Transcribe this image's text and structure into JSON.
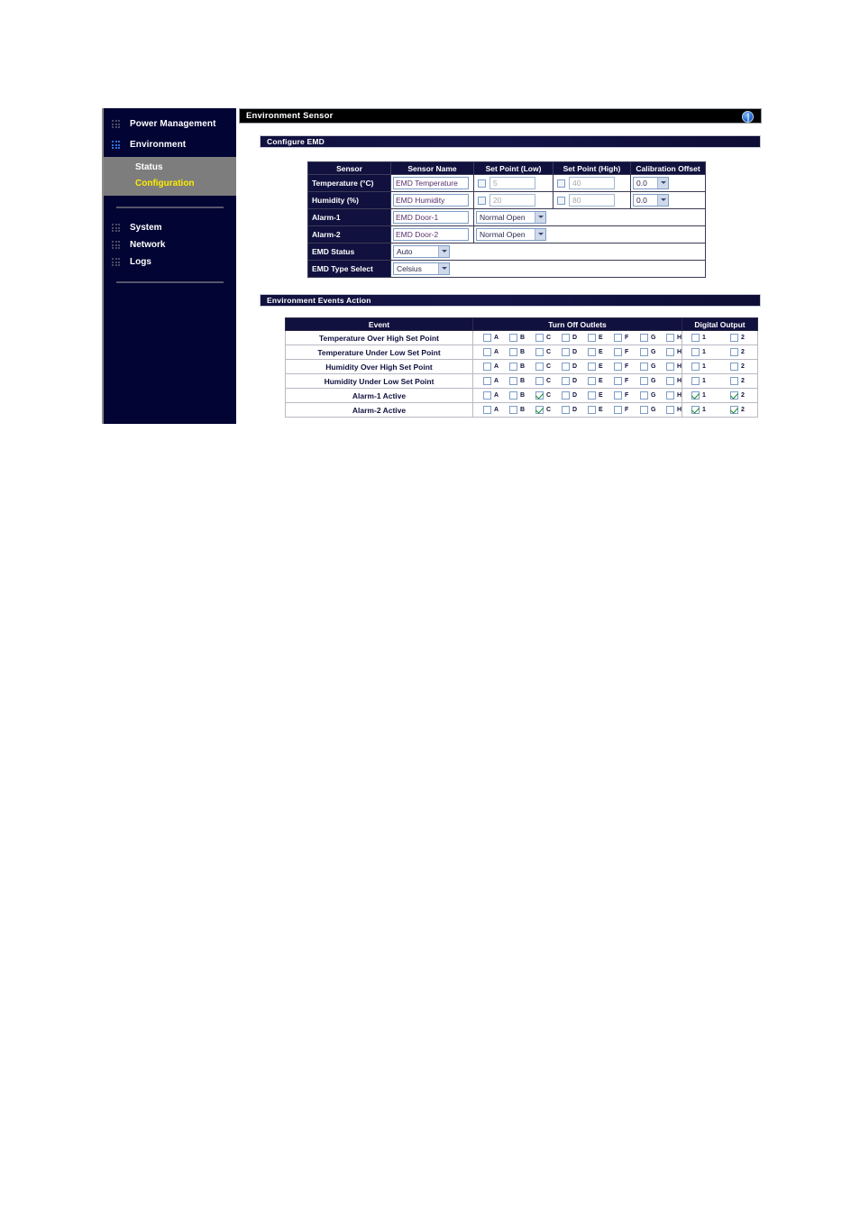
{
  "sidebar": {
    "top_items": [
      {
        "label": "Power Management",
        "icon": "grid-dots-icon",
        "active": false
      },
      {
        "label": "Environment",
        "icon": "grid-dots-icon",
        "active": true
      }
    ],
    "submenu": [
      {
        "label": "Status",
        "selected": false
      },
      {
        "label": "Configuration",
        "selected": true
      }
    ],
    "mid_items": [
      {
        "label": "System",
        "icon": "grid-dots-icon"
      },
      {
        "label": "Network",
        "icon": "grid-dots-icon"
      },
      {
        "label": "Logs",
        "icon": "grid-dots-icon"
      }
    ],
    "colors": {
      "bg": "#020433",
      "submenu_bg": "#7d7d7d",
      "selected_text": "#ffec00"
    }
  },
  "header": {
    "title": "Environment Sensor",
    "help_icon": "help-globe-icon"
  },
  "configure_emd": {
    "section_title": "Configure EMD",
    "columns": [
      "Sensor",
      "Sensor Name",
      "Set Point (Low)",
      "Set Point (High)",
      "Calibration Offset"
    ],
    "rows": [
      {
        "sensor": "Temperature (°C)",
        "sensor_name": "EMD Temperature",
        "low_enabled": false,
        "low_value": "5",
        "high_enabled": false,
        "high_value": "40",
        "calibration_offset": "0.0"
      },
      {
        "sensor": "Humidity (%)",
        "sensor_name": "EMD Humidity",
        "low_enabled": false,
        "low_value": "20",
        "high_enabled": false,
        "high_value": "80",
        "calibration_offset": "0.0"
      }
    ],
    "alarms": [
      {
        "sensor": "Alarm-1",
        "sensor_name": "EMD Door-1",
        "mode": "Normal Open"
      },
      {
        "sensor": "Alarm-2",
        "sensor_name": "EMD Door-2",
        "mode": "Normal Open"
      }
    ],
    "emd_status": {
      "label": "EMD Status",
      "value": "Auto"
    },
    "emd_type_select": {
      "label": "EMD Type Select",
      "value": "Celsius"
    }
  },
  "events_action": {
    "section_title": "Environment Events Action",
    "columns": [
      "Event",
      "Turn Off Outlets",
      "Digital Output"
    ],
    "outlet_labels": [
      "A",
      "B",
      "C",
      "D",
      "E",
      "F",
      "G",
      "H"
    ],
    "digital_labels": [
      "1",
      "2"
    ],
    "rows": [
      {
        "event": "Temperature Over High Set Point",
        "outlets": [
          false,
          false,
          false,
          false,
          false,
          false,
          false,
          false
        ],
        "digital": [
          false,
          false
        ]
      },
      {
        "event": "Temperature Under Low Set Point",
        "outlets": [
          false,
          false,
          false,
          false,
          false,
          false,
          false,
          false
        ],
        "digital": [
          false,
          false
        ]
      },
      {
        "event": "Humidity Over High Set Point",
        "outlets": [
          false,
          false,
          false,
          false,
          false,
          false,
          false,
          false
        ],
        "digital": [
          false,
          false
        ]
      },
      {
        "event": "Humidity Under Low Set Point",
        "outlets": [
          false,
          false,
          false,
          false,
          false,
          false,
          false,
          false
        ],
        "digital": [
          false,
          false
        ]
      },
      {
        "event": "Alarm-1 Active",
        "outlets": [
          false,
          false,
          true,
          false,
          false,
          false,
          false,
          false
        ],
        "digital": [
          true,
          true
        ]
      },
      {
        "event": "Alarm-2 Active",
        "outlets": [
          false,
          false,
          true,
          false,
          false,
          false,
          false,
          false
        ],
        "digital": [
          true,
          true
        ]
      }
    ]
  }
}
